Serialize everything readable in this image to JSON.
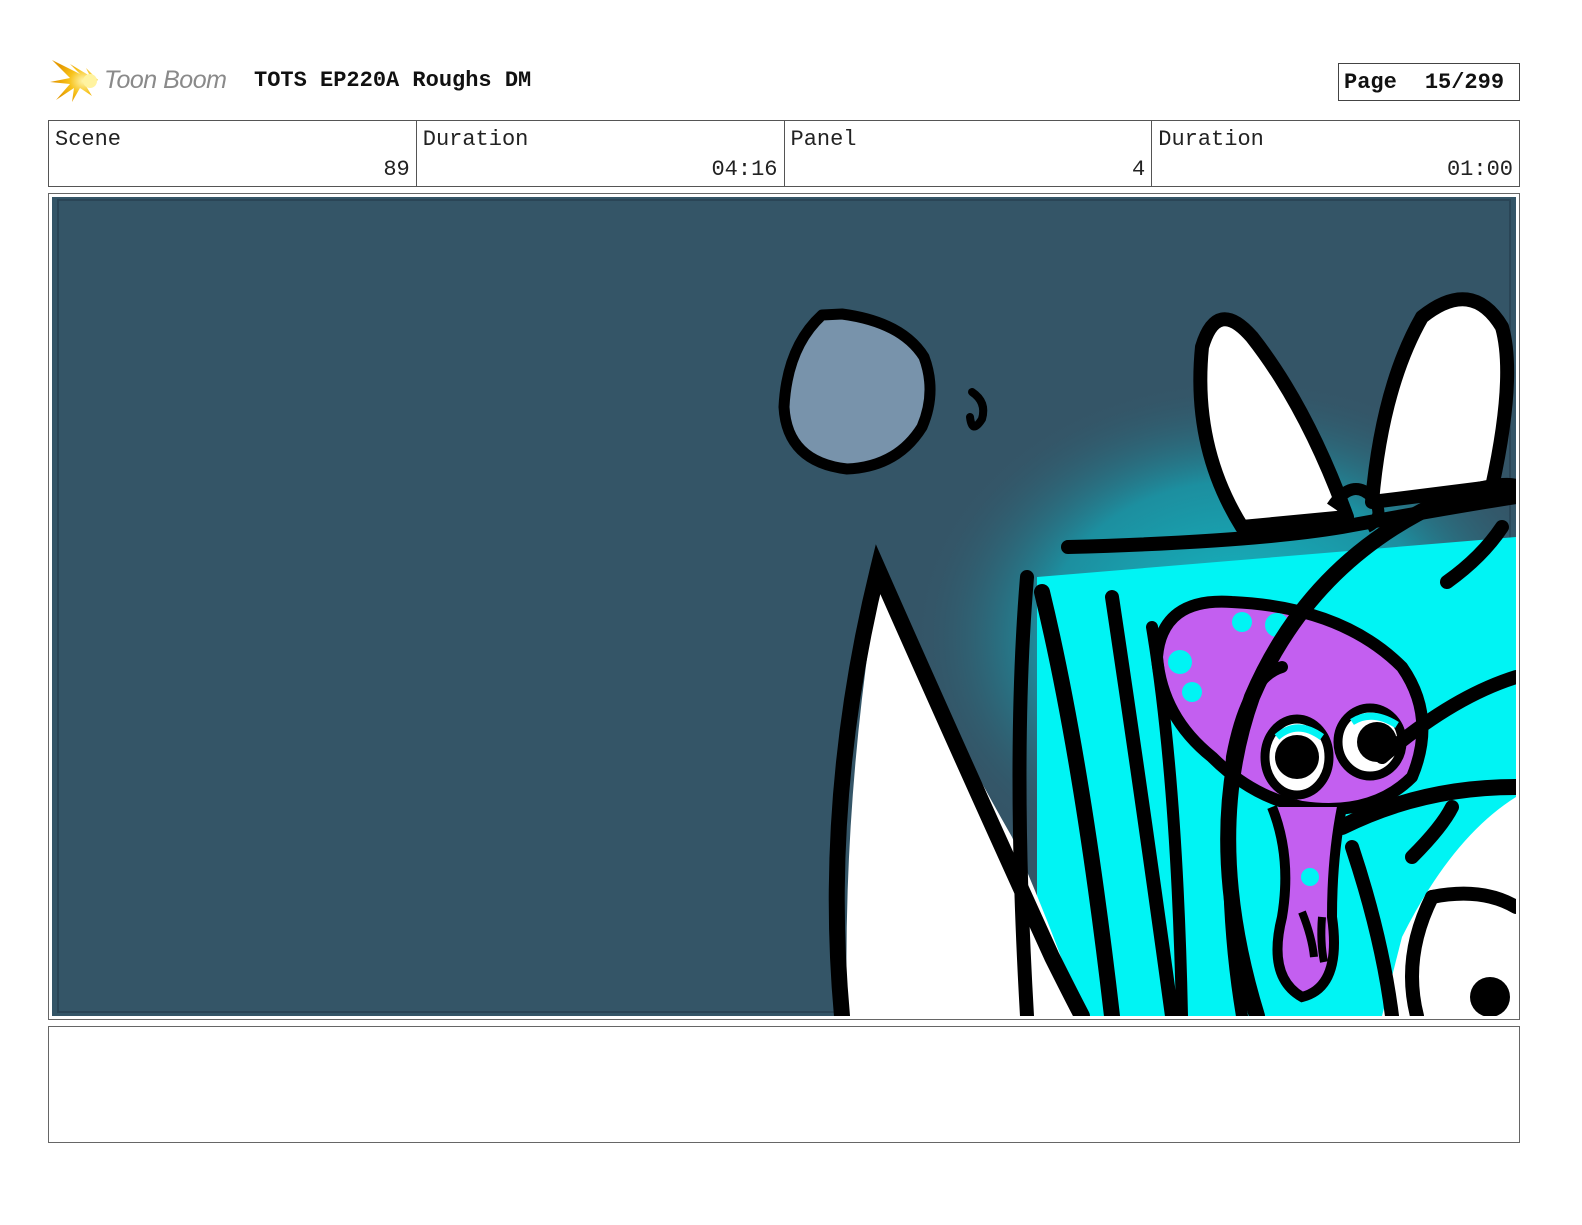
{
  "header": {
    "logo_text": "Toon Boom",
    "logo_icon": "starburst-icon",
    "title": "TOTS EP220A Roughs DM",
    "page_label": "Page",
    "page_number": "15/299"
  },
  "info": {
    "scene_label": "Scene",
    "scene_value": "89",
    "scene_duration_label": "Duration",
    "scene_duration_value": "04:16",
    "panel_label": "Panel",
    "panel_value": "4",
    "panel_duration_label": "Duration",
    "panel_duration_value": "01:00"
  },
  "colors": {
    "background": "#345567",
    "moon": "#7893ab",
    "cyan": "#00f4f4",
    "purple": "#c35ff0",
    "ink": "#000000",
    "logo_yellow": "#f7c21b"
  },
  "notes": {
    "text": ""
  }
}
